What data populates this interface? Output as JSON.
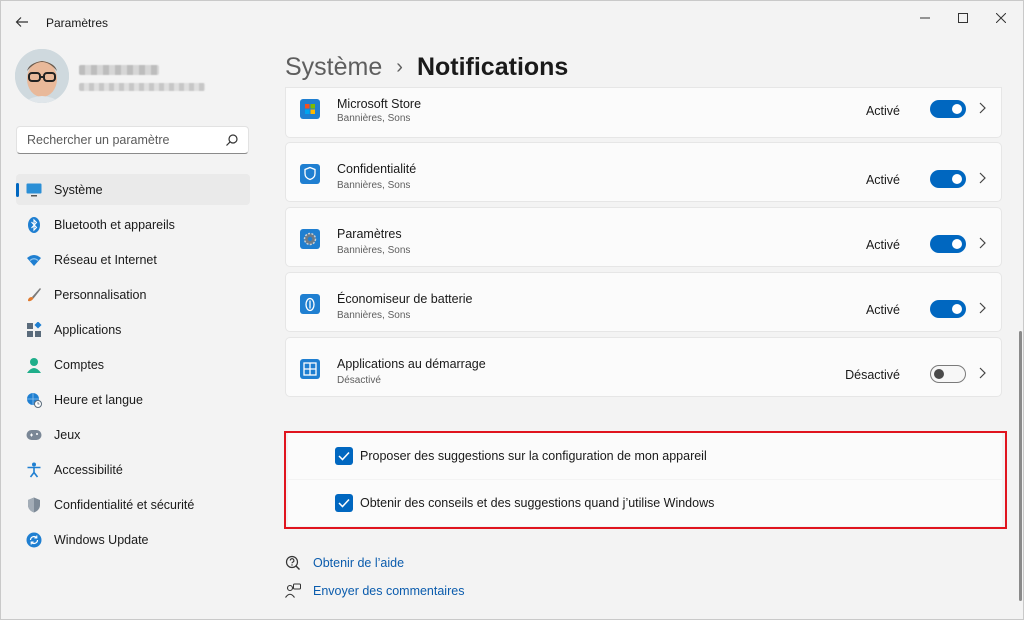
{
  "window": {
    "title": "Paramètres"
  },
  "search": {
    "placeholder": "Rechercher un paramètre"
  },
  "sidebar": {
    "items": [
      {
        "label": "Système",
        "icon": "system-icon",
        "active": true
      },
      {
        "label": "Bluetooth et appareils",
        "icon": "bluetooth-icon"
      },
      {
        "label": "Réseau et Internet",
        "icon": "wifi-icon"
      },
      {
        "label": "Personnalisation",
        "icon": "brush-icon"
      },
      {
        "label": "Applications",
        "icon": "apps-icon"
      },
      {
        "label": "Comptes",
        "icon": "account-icon"
      },
      {
        "label": "Heure et langue",
        "icon": "globe-clock-icon"
      },
      {
        "label": "Jeux",
        "icon": "gamepad-icon"
      },
      {
        "label": "Accessibilité",
        "icon": "accessibility-icon"
      },
      {
        "label": "Confidentialité et sécurité",
        "icon": "shield-icon"
      },
      {
        "label": "Windows Update",
        "icon": "update-icon"
      }
    ]
  },
  "breadcrumb": {
    "parent": "Système",
    "current": "Notifications"
  },
  "apps": [
    {
      "name": "Microsoft Store",
      "sub": "Bannières, Sons",
      "state": "Activé",
      "on": true,
      "icon": "store-icon"
    },
    {
      "name": "Confidentialité",
      "sub": "Bannières, Sons",
      "state": "Activé",
      "on": true,
      "icon": "privacy-shield-icon"
    },
    {
      "name": "Paramètres",
      "sub": "Bannières, Sons",
      "state": "Activé",
      "on": true,
      "icon": "settings-gear-icon"
    },
    {
      "name": "Économiseur de batterie",
      "sub": "Bannières, Sons",
      "state": "Activé",
      "on": true,
      "icon": "battery-saver-icon"
    },
    {
      "name": "Applications au démarrage",
      "sub": "Désactivé",
      "state": "Désactivé",
      "on": false,
      "icon": "startup-apps-icon"
    }
  ],
  "checks": [
    {
      "label": "Proposer des suggestions sur la configuration de mon appareil",
      "checked": true
    },
    {
      "label": "Obtenir des conseils et des suggestions quand j’utilise Windows",
      "checked": true
    }
  ],
  "links": [
    {
      "label": "Obtenir de l’aide",
      "icon": "help-icon"
    },
    {
      "label": "Envoyer des commentaires",
      "icon": "feedback-icon"
    }
  ],
  "colors": {
    "accent": "#0067c0",
    "highlight": "#e0141e",
    "link": "#0b5cad"
  }
}
